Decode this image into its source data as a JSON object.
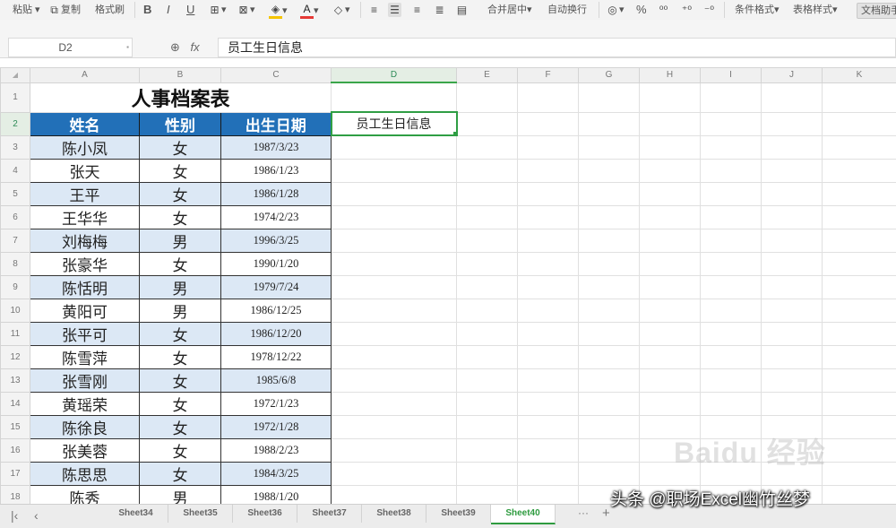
{
  "toolbar": {
    "paste": "粘贴",
    "copy": "复制",
    "format_painter": "格式刷",
    "bold": "B",
    "italic": "I",
    "underline": "U",
    "merge_center": "合并居中",
    "wrap_text": "自动换行",
    "percent": "%",
    "conditional_format": "条件格式",
    "table_style": "表格样式",
    "doc_helper": "文档助手"
  },
  "formula_bar": {
    "cell_ref": "D2",
    "fx_label": "fx",
    "content": "员工生日信息"
  },
  "columns": [
    "A",
    "B",
    "C",
    "D",
    "E",
    "F",
    "G",
    "H",
    "I",
    "J",
    "K"
  ],
  "selected_column": "D",
  "sheet": {
    "title": "人事档案表",
    "headers": [
      "姓名",
      "性别",
      "出生日期"
    ],
    "active_cell_text": "员工生日信息",
    "rows": [
      {
        "num": "3",
        "name": "陈小凤",
        "gender": "女",
        "dob": "1987/3/23"
      },
      {
        "num": "4",
        "name": "张天",
        "gender": "女",
        "dob": "1986/1/23"
      },
      {
        "num": "5",
        "name": "王平",
        "gender": "女",
        "dob": "1986/1/28"
      },
      {
        "num": "6",
        "name": "王华华",
        "gender": "女",
        "dob": "1974/2/23"
      },
      {
        "num": "7",
        "name": "刘梅梅",
        "gender": "男",
        "dob": "1996/3/25"
      },
      {
        "num": "8",
        "name": "张豪华",
        "gender": "女",
        "dob": "1990/1/20"
      },
      {
        "num": "9",
        "name": "陈恬明",
        "gender": "男",
        "dob": "1979/7/24"
      },
      {
        "num": "10",
        "name": "黄阳可",
        "gender": "男",
        "dob": "1986/12/25"
      },
      {
        "num": "11",
        "name": "张平可",
        "gender": "女",
        "dob": "1986/12/20"
      },
      {
        "num": "12",
        "name": "陈雪萍",
        "gender": "女",
        "dob": "1978/12/22"
      },
      {
        "num": "13",
        "name": "张雪刚",
        "gender": "女",
        "dob": "1985/6/8"
      },
      {
        "num": "14",
        "name": "黄瑶荣",
        "gender": "女",
        "dob": "1972/1/23"
      },
      {
        "num": "15",
        "name": "陈徐良",
        "gender": "女",
        "dob": "1972/1/28"
      },
      {
        "num": "16",
        "name": "张美蓉",
        "gender": "女",
        "dob": "1988/2/23"
      },
      {
        "num": "17",
        "name": "陈思思",
        "gender": "女",
        "dob": "1984/3/25"
      },
      {
        "num": "18",
        "name": "陈秀",
        "gender": "男",
        "dob": "1988/1/20"
      }
    ]
  },
  "sheet_tabs": [
    "Sheet34",
    "Sheet35",
    "Sheet36",
    "Sheet37",
    "Sheet38",
    "Sheet39",
    "Sheet40"
  ],
  "active_tab": "Sheet40",
  "watermark": "Baidu 经验",
  "credit": "头条 @职场Excel幽竹丝梦"
}
